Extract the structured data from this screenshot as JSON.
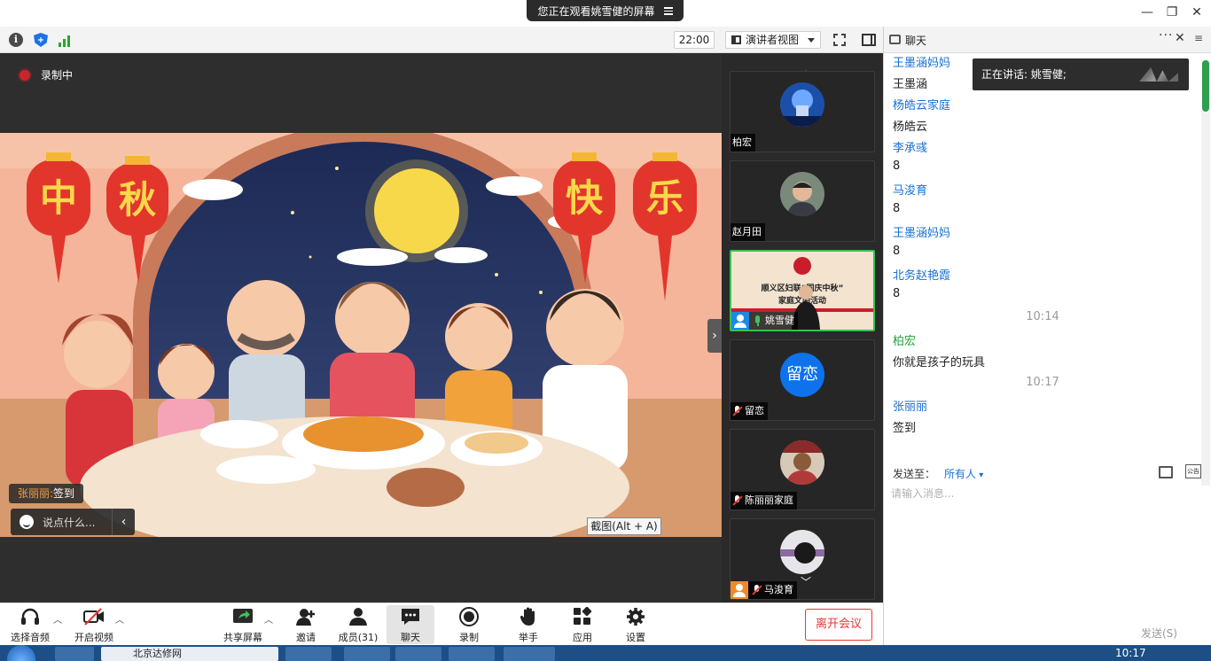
{
  "window": {
    "share_banner": "您正在观看姚雪健的屏幕",
    "minimize": "—",
    "restore": "❐",
    "close": "✕"
  },
  "toolbar": {
    "info": "i",
    "timer": "22:00",
    "view_mode": "演讲者视图"
  },
  "stage": {
    "recording_label": "录制中",
    "screenshot_tip": "截图(Alt + A)",
    "chat_bubble": {
      "sender": "张丽丽:",
      "text": "签到"
    },
    "say_placeholder": "说点什么...",
    "collapse": "‹",
    "gallery_toggle": "›"
  },
  "poster": {
    "lantern_chars": [
      "中",
      "秋",
      "快",
      "乐"
    ]
  },
  "participants": {
    "scroll_up": "︿",
    "scroll_down": "﹀",
    "tiles": [
      {
        "name": "柏宏",
        "muted": false,
        "kind": "photo"
      },
      {
        "name": "赵月田",
        "muted": false,
        "kind": "photo"
      },
      {
        "name": "姚雪健",
        "muted": false,
        "kind": "sharing",
        "active": true,
        "poster_line1": "顺义区妇联“",
        "poster_line1b": "国庆中秋”",
        "poster_line2": "家庭文明",
        "poster_line2b": "活动"
      },
      {
        "name": "留恋",
        "muted": true,
        "kind": "initials",
        "initials": "留恋"
      },
      {
        "name": "陈丽丽家庭",
        "muted": true,
        "kind": "photo"
      },
      {
        "name": "马浚育",
        "muted": true,
        "kind": "photo"
      }
    ]
  },
  "chat": {
    "title": "聊天",
    "more": "···",
    "close": "✕",
    "menu": "≡",
    "speaking_now": "正在讲话: 姚雪健;",
    "messages": [
      {
        "type": "sender",
        "text": "王墨涵妈妈"
      },
      {
        "type": "text",
        "text": "王墨涵"
      },
      {
        "type": "sender",
        "text": "杨皓云家庭"
      },
      {
        "type": "text",
        "text": "杨皓云"
      },
      {
        "type": "sender",
        "text": "李承彧"
      },
      {
        "type": "text",
        "text": "8"
      },
      {
        "type": "sender",
        "text": "马浚育"
      },
      {
        "type": "text",
        "text": "8"
      },
      {
        "type": "sender",
        "text": "王墨涵妈妈"
      },
      {
        "type": "text",
        "text": "8"
      },
      {
        "type": "sender",
        "text": "北务赵艳霞"
      },
      {
        "type": "text",
        "text": "8"
      },
      {
        "type": "time",
        "text": "10:14"
      },
      {
        "type": "sender-green",
        "text": "柏宏"
      },
      {
        "type": "text",
        "text": "你就是孩子的玩具"
      },
      {
        "type": "time",
        "text": "10:17"
      },
      {
        "type": "sender",
        "text": "张丽丽"
      },
      {
        "type": "text",
        "text": "签到"
      }
    ],
    "send_to_label": "发送至：",
    "send_to_target": "所有人",
    "notice_icon_text": "公告",
    "input_placeholder": "请输入消息...",
    "send_button": "发送(S)"
  },
  "controls": {
    "audio": "选择音频",
    "video": "开启视频",
    "share": "共享屏幕",
    "invite": "邀请",
    "members": "成员(31)",
    "chat": "聊天",
    "record": "录制",
    "raise_hand": "举手",
    "apps": "应用",
    "settings": "设置",
    "leave": "离开会议",
    "chevron": "︿"
  },
  "taskbar": {
    "browser_task": "北京达修网",
    "clock": "10:17"
  },
  "colors": {
    "accent": "#0e72ed",
    "chat_sender": "#1670d6",
    "chat_sender_self": "#23a23b",
    "leave": "#e53935",
    "recording": "#c8262c",
    "active_tile": "#35c24a"
  }
}
